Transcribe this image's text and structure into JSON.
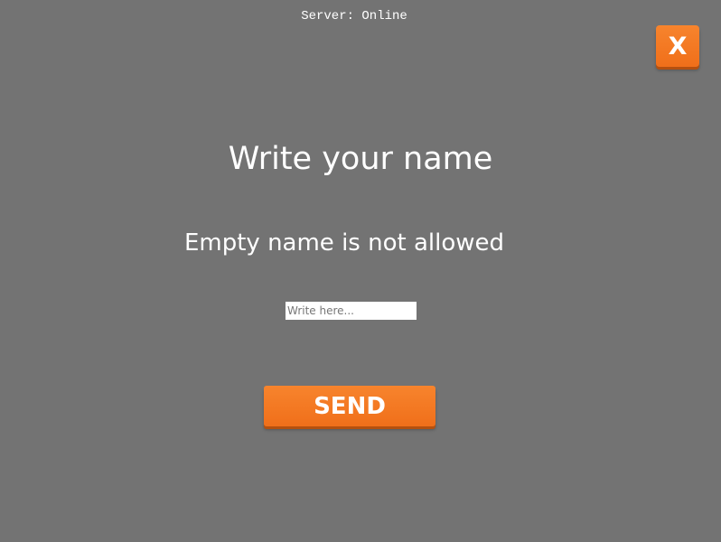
{
  "status": {
    "server": "Server: Online"
  },
  "close_button": {
    "label": "X",
    "color": "#f37a24"
  },
  "dialog": {
    "title": "Write your name",
    "error": "Empty name is not allowed"
  },
  "name_input": {
    "value": "",
    "placeholder": "Write here..."
  },
  "send_button": {
    "label": "SEND",
    "color": "#f37a24"
  },
  "colors": {
    "background": "#737373",
    "accent": "#f37a24",
    "text": "#ffffff"
  }
}
